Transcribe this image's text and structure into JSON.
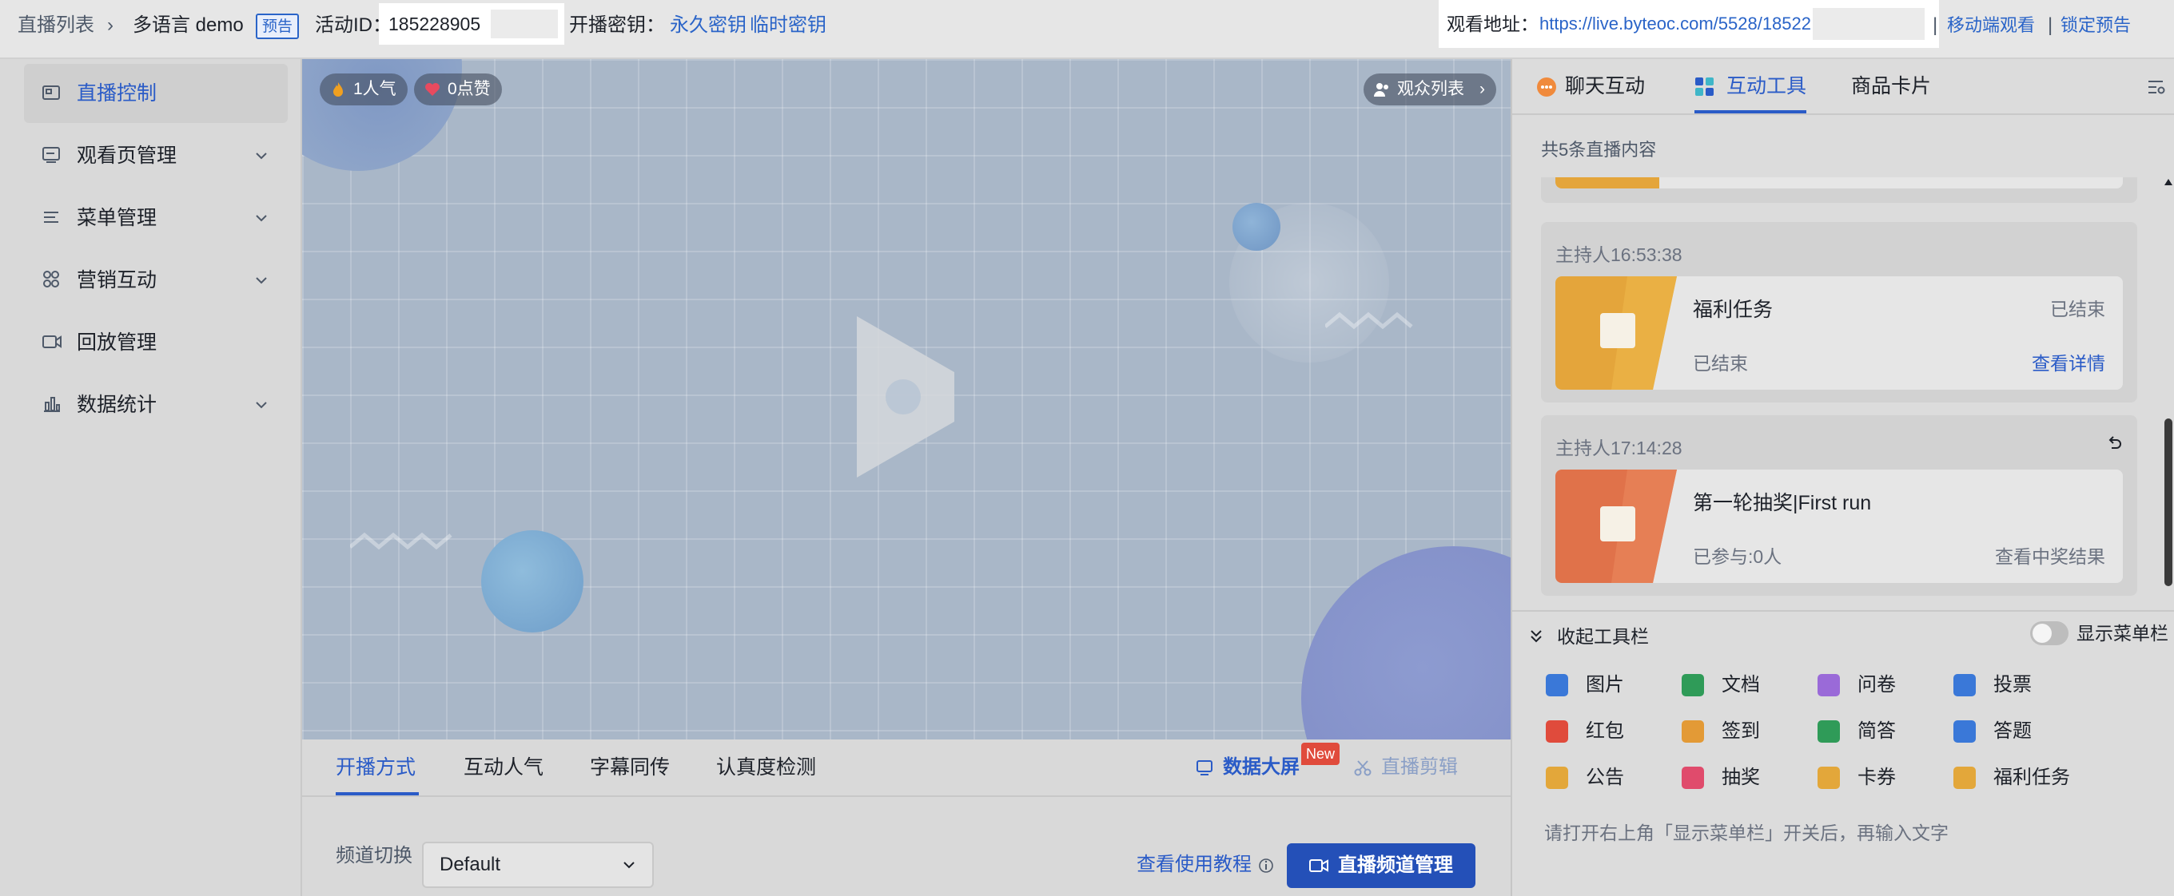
{
  "topbar": {
    "breadcrumb_root": "直播列表",
    "breadcrumb_sep": "›",
    "event_name": "多语言 demo",
    "status_badge": "预告",
    "activity_id_label": "活动ID：",
    "activity_id_value": "18522890​5",
    "stream_key_label": "开播密钥：",
    "permanent_key": "永久密钥",
    "temp_key": "临时密钥",
    "watch_url_label": "观看地址：",
    "watch_url": "https://live.byteoc.com/5528/18522",
    "sep": "|",
    "mobile_watch": "移动端观看",
    "lock_preview": "锁定预告"
  },
  "sidebar": {
    "items": [
      {
        "label": "直播控制",
        "icon": "live-control-icon",
        "active": true
      },
      {
        "label": "观看页管理",
        "icon": "watch-page-icon"
      },
      {
        "label": "菜单管理",
        "icon": "menu-icon"
      },
      {
        "label": "营销互动",
        "icon": "marketing-icon"
      },
      {
        "label": "回放管理",
        "icon": "replay-icon"
      },
      {
        "label": "数据统计",
        "icon": "stats-icon"
      }
    ]
  },
  "video": {
    "popularity": "1人气",
    "likes": "0点赞",
    "audience_list": "观众列表",
    "audience_chevron": "›"
  },
  "lower": {
    "tabs": [
      "开播方式",
      "互动人气",
      "字幕同传",
      "认真度检测"
    ],
    "big_screen": "数据大屏",
    "new_badge": "New",
    "live_clip": "直播剪辑",
    "channel_label": "频道切换",
    "channel_value": "Default",
    "tutorial_link": "查看使用教程",
    "channel_manage": "直播频道管理"
  },
  "rpanel": {
    "tabs": [
      "聊天互动",
      "互动工具",
      "商品卡片"
    ],
    "total": "共5条直播内容",
    "cards": [
      {
        "host_time": "主持人16:53:38",
        "title": "福利任务",
        "status_right": "已结束",
        "status_left": "已结束",
        "action": "查看详情",
        "thumb_color": "#e4a53b"
      },
      {
        "host_time": "主持人17:14:28",
        "title": "第一轮抽奖|First run",
        "status_left": "已参与:0人",
        "action": "查看中奖结果",
        "thumb_color": "#e0724a"
      }
    ],
    "collapse_label": "收起工具栏",
    "show_menu_label": "显示菜单栏",
    "tools": [
      {
        "label": "图片",
        "color": "#3a78d8"
      },
      {
        "label": "文档",
        "color": "#2f9b58"
      },
      {
        "label": "问卷",
        "color": "#9a6ad8"
      },
      {
        "label": "投票",
        "color": "#3a78d8"
      },
      {
        "label": "红包",
        "color": "#e04b3c"
      },
      {
        "label": "签到",
        "color": "#e39a36"
      },
      {
        "label": "简答",
        "color": "#2f9b58"
      },
      {
        "label": "答题",
        "color": "#3a78d8"
      },
      {
        "label": "公告",
        "color": "#e3a73a"
      },
      {
        "label": "抽奖",
        "color": "#e04b6c"
      },
      {
        "label": "卡券",
        "color": "#e3a73a"
      },
      {
        "label": "福利任务",
        "color": "#e3a73a"
      }
    ],
    "hint": "请打开右上角「显示菜单栏」开关后，再输入文字"
  },
  "colors": {
    "accent": "#2a5bc7",
    "primary_button": "#2450b8",
    "new_badge": "#e04b3c"
  }
}
